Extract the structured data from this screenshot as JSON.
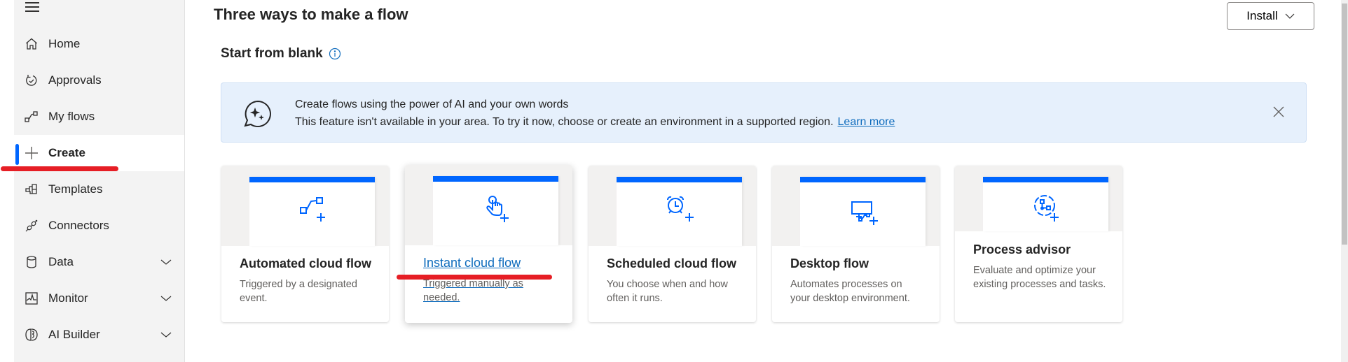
{
  "sidebar": {
    "menu_icon": "hamburger-icon",
    "items": [
      {
        "label": "Home",
        "icon": "home-icon",
        "expandable": false,
        "active": false
      },
      {
        "label": "Approvals",
        "icon": "approvals-icon",
        "expandable": false,
        "active": false
      },
      {
        "label": "My flows",
        "icon": "my-flows-icon",
        "expandable": false,
        "active": false
      },
      {
        "label": "Create",
        "icon": "plus-icon",
        "expandable": false,
        "active": true
      },
      {
        "label": "Templates",
        "icon": "templates-icon",
        "expandable": false,
        "active": false
      },
      {
        "label": "Connectors",
        "icon": "connectors-icon",
        "expandable": false,
        "active": false
      },
      {
        "label": "Data",
        "icon": "database-icon",
        "expandable": true,
        "active": false
      },
      {
        "label": "Monitor",
        "icon": "monitor-icon",
        "expandable": true,
        "active": false
      },
      {
        "label": "AI Builder",
        "icon": "brain-icon",
        "expandable": true,
        "active": false
      }
    ]
  },
  "header": {
    "title": "Three ways to make a flow",
    "install_label": "Install"
  },
  "section": {
    "title": "Start from blank"
  },
  "banner": {
    "title": "Create flows using the power of AI and your own words",
    "text": "This feature isn't available in your area. To try it now, choose or create an environment in a supported region.",
    "link": "Learn more"
  },
  "cards": [
    {
      "title": "Automated cloud flow",
      "description": "Triggered by a designated event.",
      "icon": "automated-flow-icon"
    },
    {
      "title": "Instant cloud flow",
      "description": "Triggered manually as needed.",
      "icon": "touch-hand-icon",
      "hovered": true
    },
    {
      "title": "Scheduled cloud flow",
      "description": "You choose when and how often it runs.",
      "icon": "alarm-clock-icon"
    },
    {
      "title": "Desktop flow",
      "description": "Automates processes on your desktop environment.",
      "icon": "desktop-flow-icon"
    },
    {
      "title": "Process advisor",
      "description": "Evaluate and optimize your existing processes and tasks.",
      "icon": "process-advisor-icon"
    }
  ],
  "colors": {
    "accent": "#0066ff",
    "link": "#0f6cbd",
    "annotation_red": "#e61e25",
    "banner_bg": "#e6f0fc",
    "sidebar_bg": "#f3f3f3"
  }
}
